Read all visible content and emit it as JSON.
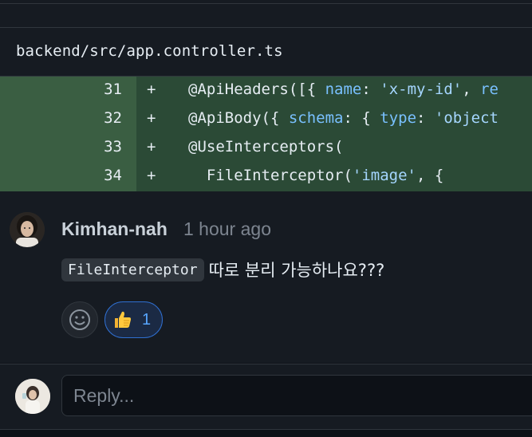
{
  "file": {
    "path": "backend/src/app.controller.ts"
  },
  "diff": {
    "marker": "+",
    "lines": [
      {
        "num": "31",
        "parts": [
          {
            "t": "@ApiHeaders([{ ",
            "c": "plain"
          },
          {
            "t": "name",
            "c": "key"
          },
          {
            "t": ": ",
            "c": "plain"
          },
          {
            "t": "'x-my-id'",
            "c": "str"
          },
          {
            "t": ", ",
            "c": "plain"
          },
          {
            "t": "re",
            "c": "key"
          }
        ]
      },
      {
        "num": "32",
        "parts": [
          {
            "t": "@ApiBody({ ",
            "c": "plain"
          },
          {
            "t": "schema",
            "c": "key"
          },
          {
            "t": ": { ",
            "c": "plain"
          },
          {
            "t": "type",
            "c": "key"
          },
          {
            "t": ": ",
            "c": "plain"
          },
          {
            "t": "'object",
            "c": "str"
          }
        ]
      },
      {
        "num": "33",
        "parts": [
          {
            "t": "@UseInterceptors(",
            "c": "plain"
          }
        ]
      },
      {
        "num": "34",
        "parts": [
          {
            "t": "  FileInterceptor(",
            "c": "plain"
          },
          {
            "t": "'image'",
            "c": "str"
          },
          {
            "t": ", {",
            "c": "plain"
          }
        ]
      }
    ]
  },
  "comment": {
    "author": "Kimhan-nah",
    "timestamp": "1 hour ago",
    "inline_code": "FileInterceptor",
    "text": "따로 분리 가능하나요???",
    "reaction_count": "1"
  },
  "reply": {
    "placeholder": "Reply..."
  },
  "colors": {
    "added_bg": "#2b4a36",
    "added_gutter": "#3a5e42",
    "key": "#79c0ff",
    "string": "#a5d6ff",
    "reaction_accent": "#58a6ff"
  }
}
